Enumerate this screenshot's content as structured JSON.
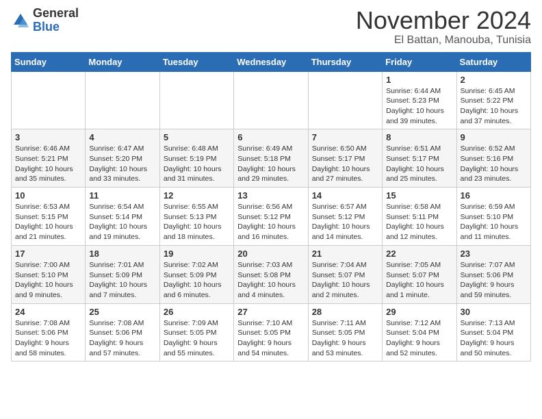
{
  "header": {
    "logo_general": "General",
    "logo_blue": "Blue",
    "month_title": "November 2024",
    "location": "El Battan, Manouba, Tunisia"
  },
  "weekdays": [
    "Sunday",
    "Monday",
    "Tuesday",
    "Wednesday",
    "Thursday",
    "Friday",
    "Saturday"
  ],
  "weeks": [
    [
      {
        "day": "",
        "info": ""
      },
      {
        "day": "",
        "info": ""
      },
      {
        "day": "",
        "info": ""
      },
      {
        "day": "",
        "info": ""
      },
      {
        "day": "",
        "info": ""
      },
      {
        "day": "1",
        "info": "Sunrise: 6:44 AM\nSunset: 5:23 PM\nDaylight: 10 hours\nand 39 minutes."
      },
      {
        "day": "2",
        "info": "Sunrise: 6:45 AM\nSunset: 5:22 PM\nDaylight: 10 hours\nand 37 minutes."
      }
    ],
    [
      {
        "day": "3",
        "info": "Sunrise: 6:46 AM\nSunset: 5:21 PM\nDaylight: 10 hours\nand 35 minutes."
      },
      {
        "day": "4",
        "info": "Sunrise: 6:47 AM\nSunset: 5:20 PM\nDaylight: 10 hours\nand 33 minutes."
      },
      {
        "day": "5",
        "info": "Sunrise: 6:48 AM\nSunset: 5:19 PM\nDaylight: 10 hours\nand 31 minutes."
      },
      {
        "day": "6",
        "info": "Sunrise: 6:49 AM\nSunset: 5:18 PM\nDaylight: 10 hours\nand 29 minutes."
      },
      {
        "day": "7",
        "info": "Sunrise: 6:50 AM\nSunset: 5:17 PM\nDaylight: 10 hours\nand 27 minutes."
      },
      {
        "day": "8",
        "info": "Sunrise: 6:51 AM\nSunset: 5:17 PM\nDaylight: 10 hours\nand 25 minutes."
      },
      {
        "day": "9",
        "info": "Sunrise: 6:52 AM\nSunset: 5:16 PM\nDaylight: 10 hours\nand 23 minutes."
      }
    ],
    [
      {
        "day": "10",
        "info": "Sunrise: 6:53 AM\nSunset: 5:15 PM\nDaylight: 10 hours\nand 21 minutes."
      },
      {
        "day": "11",
        "info": "Sunrise: 6:54 AM\nSunset: 5:14 PM\nDaylight: 10 hours\nand 19 minutes."
      },
      {
        "day": "12",
        "info": "Sunrise: 6:55 AM\nSunset: 5:13 PM\nDaylight: 10 hours\nand 18 minutes."
      },
      {
        "day": "13",
        "info": "Sunrise: 6:56 AM\nSunset: 5:12 PM\nDaylight: 10 hours\nand 16 minutes."
      },
      {
        "day": "14",
        "info": "Sunrise: 6:57 AM\nSunset: 5:12 PM\nDaylight: 10 hours\nand 14 minutes."
      },
      {
        "day": "15",
        "info": "Sunrise: 6:58 AM\nSunset: 5:11 PM\nDaylight: 10 hours\nand 12 minutes."
      },
      {
        "day": "16",
        "info": "Sunrise: 6:59 AM\nSunset: 5:10 PM\nDaylight: 10 hours\nand 11 minutes."
      }
    ],
    [
      {
        "day": "17",
        "info": "Sunrise: 7:00 AM\nSunset: 5:10 PM\nDaylight: 10 hours\nand 9 minutes."
      },
      {
        "day": "18",
        "info": "Sunrise: 7:01 AM\nSunset: 5:09 PM\nDaylight: 10 hours\nand 7 minutes."
      },
      {
        "day": "19",
        "info": "Sunrise: 7:02 AM\nSunset: 5:09 PM\nDaylight: 10 hours\nand 6 minutes."
      },
      {
        "day": "20",
        "info": "Sunrise: 7:03 AM\nSunset: 5:08 PM\nDaylight: 10 hours\nand 4 minutes."
      },
      {
        "day": "21",
        "info": "Sunrise: 7:04 AM\nSunset: 5:07 PM\nDaylight: 10 hours\nand 2 minutes."
      },
      {
        "day": "22",
        "info": "Sunrise: 7:05 AM\nSunset: 5:07 PM\nDaylight: 10 hours\nand 1 minute."
      },
      {
        "day": "23",
        "info": "Sunrise: 7:07 AM\nSunset: 5:06 PM\nDaylight: 9 hours\nand 59 minutes."
      }
    ],
    [
      {
        "day": "24",
        "info": "Sunrise: 7:08 AM\nSunset: 5:06 PM\nDaylight: 9 hours\nand 58 minutes."
      },
      {
        "day": "25",
        "info": "Sunrise: 7:08 AM\nSunset: 5:06 PM\nDaylight: 9 hours\nand 57 minutes."
      },
      {
        "day": "26",
        "info": "Sunrise: 7:09 AM\nSunset: 5:05 PM\nDaylight: 9 hours\nand 55 minutes."
      },
      {
        "day": "27",
        "info": "Sunrise: 7:10 AM\nSunset: 5:05 PM\nDaylight: 9 hours\nand 54 minutes."
      },
      {
        "day": "28",
        "info": "Sunrise: 7:11 AM\nSunset: 5:05 PM\nDaylight: 9 hours\nand 53 minutes."
      },
      {
        "day": "29",
        "info": "Sunrise: 7:12 AM\nSunset: 5:04 PM\nDaylight: 9 hours\nand 52 minutes."
      },
      {
        "day": "30",
        "info": "Sunrise: 7:13 AM\nSunset: 5:04 PM\nDaylight: 9 hours\nand 50 minutes."
      }
    ]
  ]
}
